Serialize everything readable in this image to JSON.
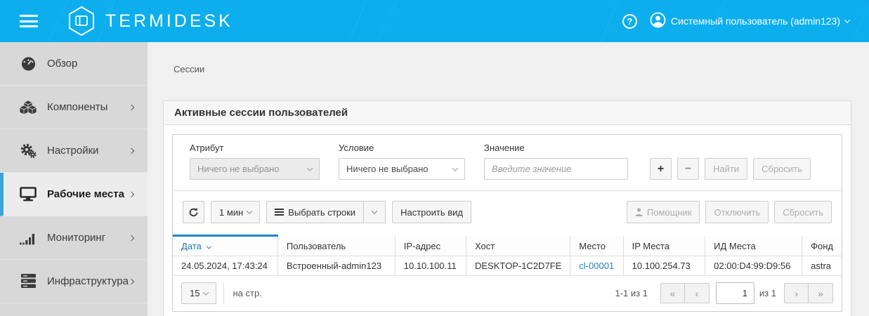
{
  "colors": {
    "accent": "#0caeed",
    "active_border": "#3ba5d9",
    "sort_bar": "#1e87c4",
    "link": "#2a80c4"
  },
  "header": {
    "brand": "TERMIDESK",
    "help_glyph": "?",
    "user_name": "Системный пользователь (admin123)"
  },
  "sidebar": {
    "items": [
      {
        "label": "Обзор",
        "icon": "dashboard-icon",
        "active": false,
        "expandable": false
      },
      {
        "label": "Компоненты",
        "icon": "cubes-icon",
        "active": false,
        "expandable": true
      },
      {
        "label": "Настройки",
        "icon": "gears-icon",
        "active": false,
        "expandable": true
      },
      {
        "label": "Рабочие места",
        "icon": "monitor-icon",
        "active": true,
        "expandable": true
      },
      {
        "label": "Мониторинг",
        "icon": "signal-bars-icon",
        "active": false,
        "expandable": true
      },
      {
        "label": "Инфраструктура",
        "icon": "server-stack-icon",
        "active": false,
        "expandable": true
      }
    ]
  },
  "breadcrumb": "Сессии",
  "panel": {
    "title": "Активные сессии пользователей",
    "filter": {
      "attribute_label": "Атрибут",
      "attribute_value": "Ничего не выбрано",
      "condition_label": "Условие",
      "condition_value": "Ничего не выбрано",
      "value_label": "Значение",
      "value_placeholder": "Введите значение",
      "add_label": "+",
      "remove_label": "−",
      "find_label": "Найти",
      "reset_label": "Сбросить"
    },
    "toolbar": {
      "interval_value": "1 мин",
      "select_rows_label": "Выбрать строки",
      "configure_view_label": "Настроить вид",
      "assistant_label": "Помощник",
      "disconnect_label": "Отключить",
      "reset_label": "Сбросить"
    },
    "table": {
      "columns": [
        "Дата",
        "Пользователь",
        "IP-адрес",
        "Хост",
        "Место",
        "IP Места",
        "ИД Места",
        "Фонд"
      ],
      "rows": [
        {
          "date": "24.05.2024, 17:43:24",
          "user": "Встроенный-admin123",
          "ip": "10.10.100.11",
          "host": "DESKTOP-1C2D7FE",
          "place": "cl-00001",
          "place_ip": "10.100.254.73",
          "place_id": "02:00:D4:99:D9:56",
          "pool": "astra"
        }
      ]
    },
    "pagination": {
      "per_page": "15",
      "per_page_suffix": "на стр.",
      "range_text": "1-1 из 1",
      "first_glyph": "«",
      "prev_glyph": "‹",
      "next_glyph": "›",
      "last_glyph": "»",
      "page_value": "1",
      "of_text": "из 1"
    }
  }
}
